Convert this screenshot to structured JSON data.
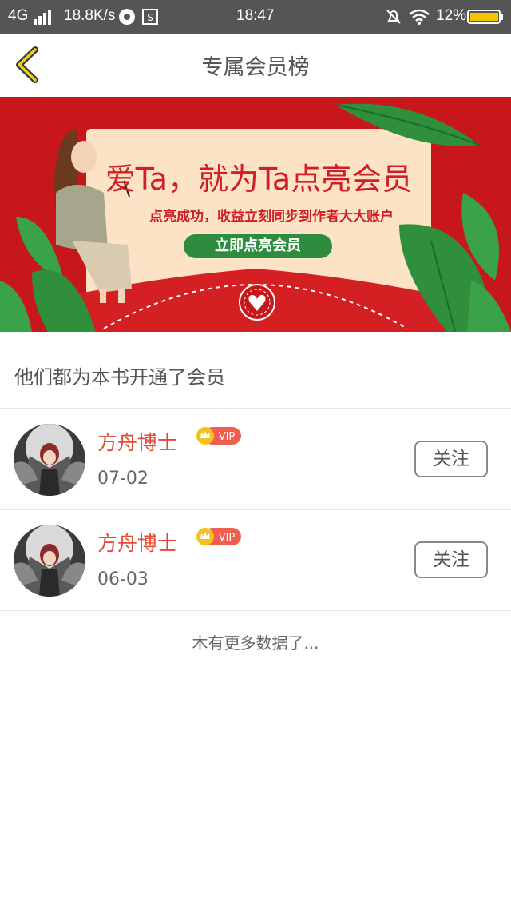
{
  "status_bar": {
    "network": "4G",
    "speed": "18.8K/s",
    "time": "18:47",
    "battery": "12%"
  },
  "header": {
    "title": "专属会员榜",
    "back_icon": "chevron-left-icon"
  },
  "banner": {
    "title": "爱Ta，就为Ta点亮会员",
    "subtitle": "点亮成功，收益立刻同步到作者大大账户",
    "cta": "立即点亮会员"
  },
  "section": {
    "heading": "他们都为本书开通了会员"
  },
  "members": [
    {
      "name": "方舟博士",
      "badge": "VIP",
      "date": "07-02",
      "follow_label": "关注"
    },
    {
      "name": "方舟博士",
      "badge": "VIP",
      "date": "06-03",
      "follow_label": "关注"
    }
  ],
  "footer": {
    "no_more": "木有更多数据了..."
  },
  "colors": {
    "banner_red": "#c8171b",
    "name_red": "#e34a35",
    "cta_green": "#2e8c3e",
    "back_yellow": "#d9b800"
  }
}
